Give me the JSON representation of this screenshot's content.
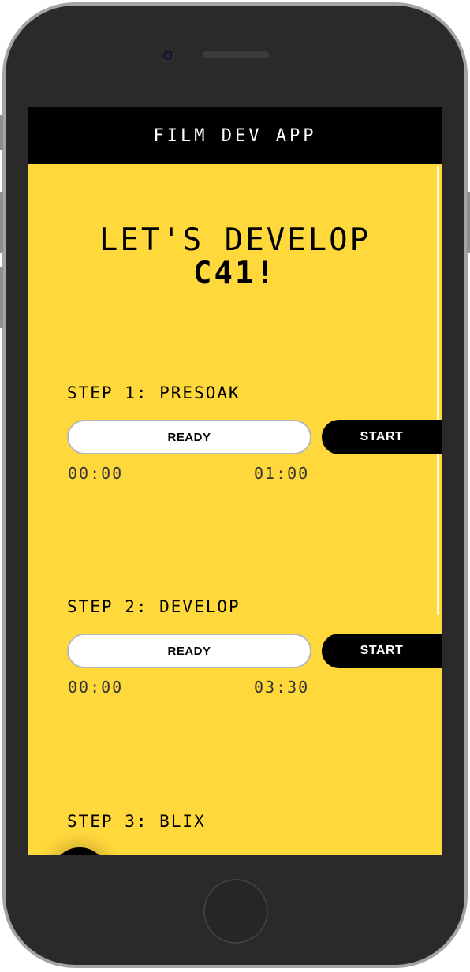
{
  "header": {
    "title": "FILM DEV APP"
  },
  "hero": {
    "line1": "LET'S DEVELOP",
    "line2": "C41!"
  },
  "steps": [
    {
      "title": "STEP 1: PRESOAK",
      "status": "READY",
      "action": "START",
      "elapsed": "00:00",
      "duration": "01:00"
    },
    {
      "title": "STEP 2: DEVELOP",
      "status": "READY",
      "action": "START",
      "elapsed": "00:00",
      "duration": "03:30"
    },
    {
      "title": "STEP 3: BLIX"
    }
  ],
  "colors": {
    "background": "#ffd83c",
    "header": "#000000",
    "pill": "#ffffff",
    "button": "#000000"
  }
}
